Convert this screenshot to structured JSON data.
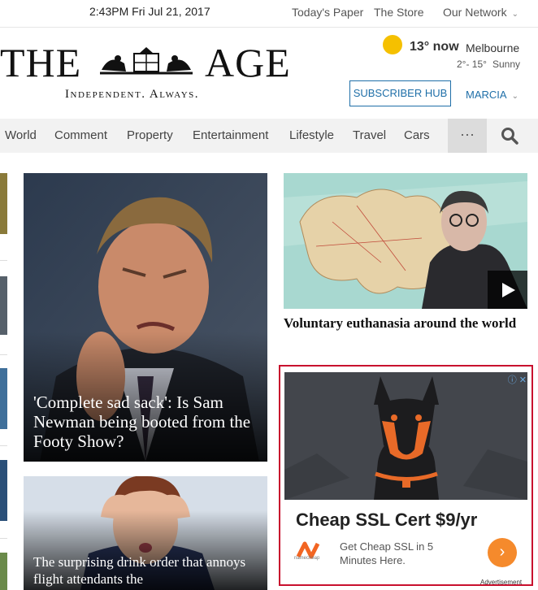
{
  "topbar": {
    "datetime": "2:43PM Fri Jul 21, 2017",
    "links": [
      "Today's Paper",
      "The Store",
      "Our Network"
    ]
  },
  "masthead": {
    "logo_left": "THE",
    "logo_right": "AGE",
    "tagline": "Independent. Always."
  },
  "weather": {
    "temp_now": "13° now",
    "city": "Melbourne",
    "range": "2°- 15°",
    "condition": "Sunny"
  },
  "account": {
    "subscriber_hub": "SUBSCRIBER HUB",
    "user": "MARCIA"
  },
  "nav": {
    "items": [
      "World",
      "Comment",
      "Property",
      "Entertainment",
      "Lifestyle",
      "Travel",
      "Cars"
    ],
    "more": "···"
  },
  "stories": [
    {
      "headline": "'Complete sad sack': Is Sam Newman being booted from the Footy Show?"
    },
    {
      "headline": "Voluntary euthanasia around the world"
    },
    {
      "headline": "The surprising drink order that annoys flight attendants the"
    }
  ],
  "ad": {
    "title": "Cheap SSL Cert $9/yr",
    "body": "Get Cheap SSL in 5 Minutes Here.",
    "advertiser": "namecheap",
    "label": "Advertisement"
  },
  "colors": {
    "accent_blue": "#1f6fa8",
    "ad_border": "#c8102e",
    "sun": "#f5c000",
    "ad_button": "#f58a2c"
  }
}
